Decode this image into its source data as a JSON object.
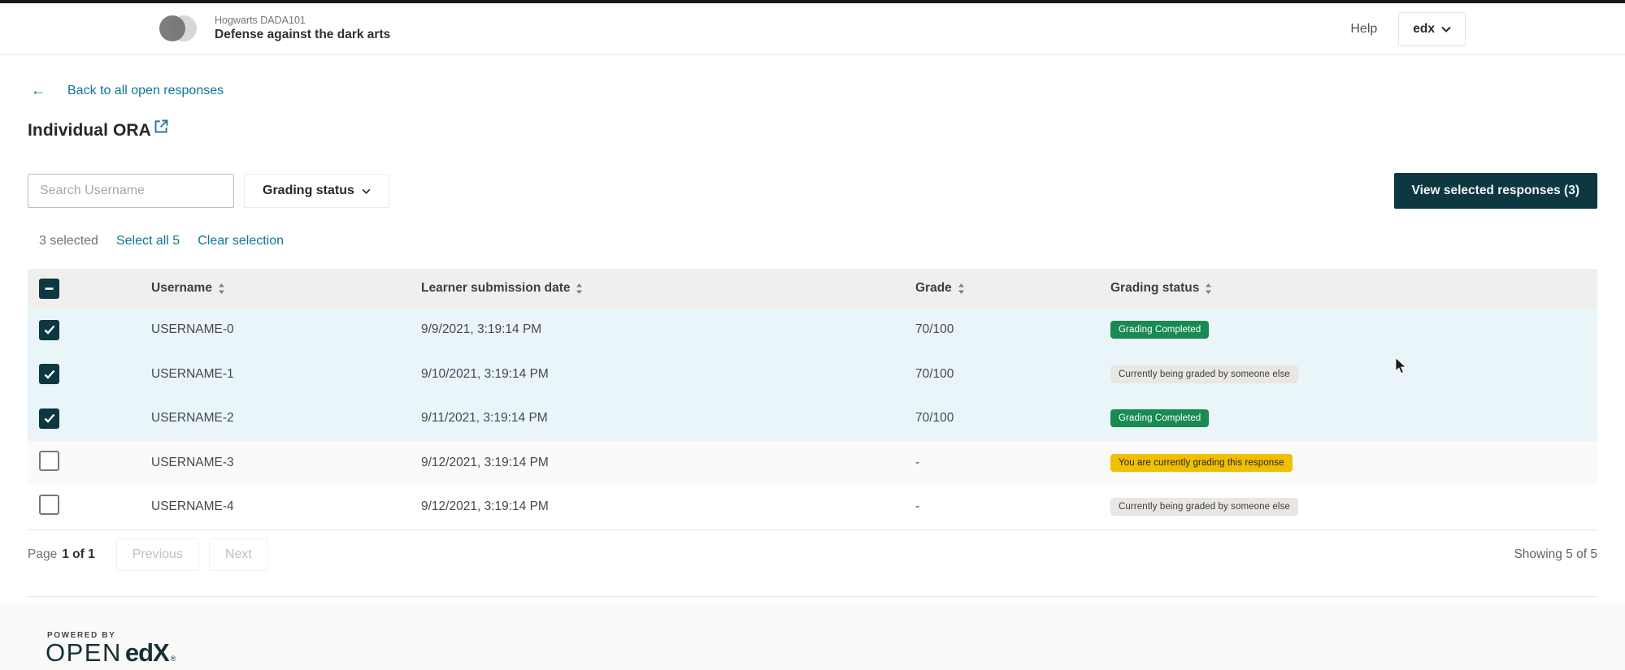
{
  "header": {
    "course_org": "Hogwarts DADA101",
    "course_title": "Defense against the dark arts",
    "help_label": "Help",
    "user_menu_label": "edx"
  },
  "page": {
    "back_link_label": "Back to all open responses",
    "title": "Individual ORA"
  },
  "icons": {
    "back_arrow": "←"
  },
  "controls": {
    "search_placeholder": "Search Username",
    "search_value": "",
    "grading_status_filter_label": "Grading status",
    "view_selected_button_label": "View selected responses (3)",
    "selected_count_text": "3 selected",
    "select_all_link_label": "Select all 5",
    "clear_selection_link_label": "Clear selection"
  },
  "table": {
    "columns": {
      "username": "Username",
      "submission_date": "Learner submission date",
      "grade": "Grade",
      "grading_status": "Grading status"
    },
    "header_checkbox_state": "indeterminate",
    "rows": [
      {
        "checked": true,
        "username": "USERNAME-0",
        "submission_date": "9/9/2021, 3:19:14 PM",
        "grade": "70/100",
        "status": "Grading Completed",
        "status_type": "success"
      },
      {
        "checked": true,
        "username": "USERNAME-1",
        "submission_date": "9/10/2021, 3:19:14 PM",
        "grade": "70/100",
        "status": "Currently being graded by someone else",
        "status_type": "other"
      },
      {
        "checked": true,
        "username": "USERNAME-2",
        "submission_date": "9/11/2021, 3:19:14 PM",
        "grade": "70/100",
        "status": "Grading Completed",
        "status_type": "success"
      },
      {
        "checked": false,
        "username": "USERNAME-3",
        "submission_date": "9/12/2021, 3:19:14 PM",
        "grade": "-",
        "status": "You are currently grading this response",
        "status_type": "mine"
      },
      {
        "checked": false,
        "username": "USERNAME-4",
        "submission_date": "9/12/2021, 3:19:14 PM",
        "grade": "-",
        "status": "Currently being graded by someone else",
        "status_type": "other"
      }
    ]
  },
  "pagination": {
    "page_label": "Page",
    "page_value": "1 of 1",
    "previous_label": "Previous",
    "next_label": "Next",
    "showing_text": "Showing 5 of 5"
  },
  "footer": {
    "powered_by": "POWERED BY",
    "logo_open": "OPEN",
    "logo_edx": "edX",
    "logo_reg": "®"
  },
  "colors": {
    "accent_link": "#0e7695",
    "primary_button_bg": "#0d3741",
    "badge_success_bg": "#188a52",
    "badge_other_bg": "#e9e6e3",
    "badge_mine_bg": "#f0c000",
    "selected_row_bg": "#e9f5f8",
    "table_header_bg": "#f1efed"
  }
}
